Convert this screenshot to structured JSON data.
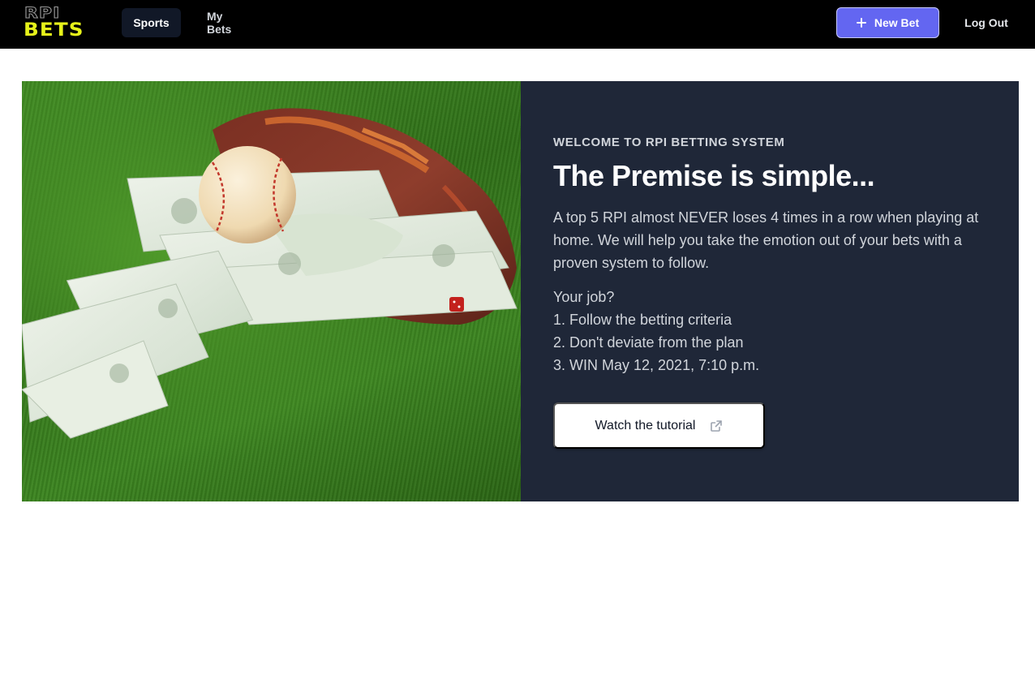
{
  "brand": {
    "logo_top": "RPI",
    "logo_bottom": "BETS",
    "logo_colors": {
      "top": "#9a9a9a",
      "bottom": "#e6f21a"
    }
  },
  "nav": {
    "items": [
      {
        "label": "Sports",
        "active": true
      },
      {
        "label": "My Bets",
        "active": false
      }
    ],
    "new_bet_label": "New Bet",
    "new_bet_icon": "plus-icon",
    "logout_label": "Log Out"
  },
  "hero": {
    "image_alt": "baseball-glove-with-cash-on-grass",
    "eyebrow": "WELCOME TO RPI BETTING SYSTEM",
    "headline": "The Premise is simple...",
    "description": "A top 5 RPI almost NEVER loses 4 times in a row when playing at home. We will help you take the emotion out of your bets with a proven system to follow.",
    "job_heading": "Your job?",
    "job_steps": [
      "1. Follow the betting criteria",
      "2. Don't deviate from the plan",
      "3. WIN May 12, 2021, 7:10 p.m."
    ],
    "tutorial_button": "Watch the tutorial",
    "tutorial_icon": "external-link-icon"
  },
  "colors": {
    "navbar": "#000000",
    "accent": "#6366f1",
    "panel": "#1f2738"
  }
}
